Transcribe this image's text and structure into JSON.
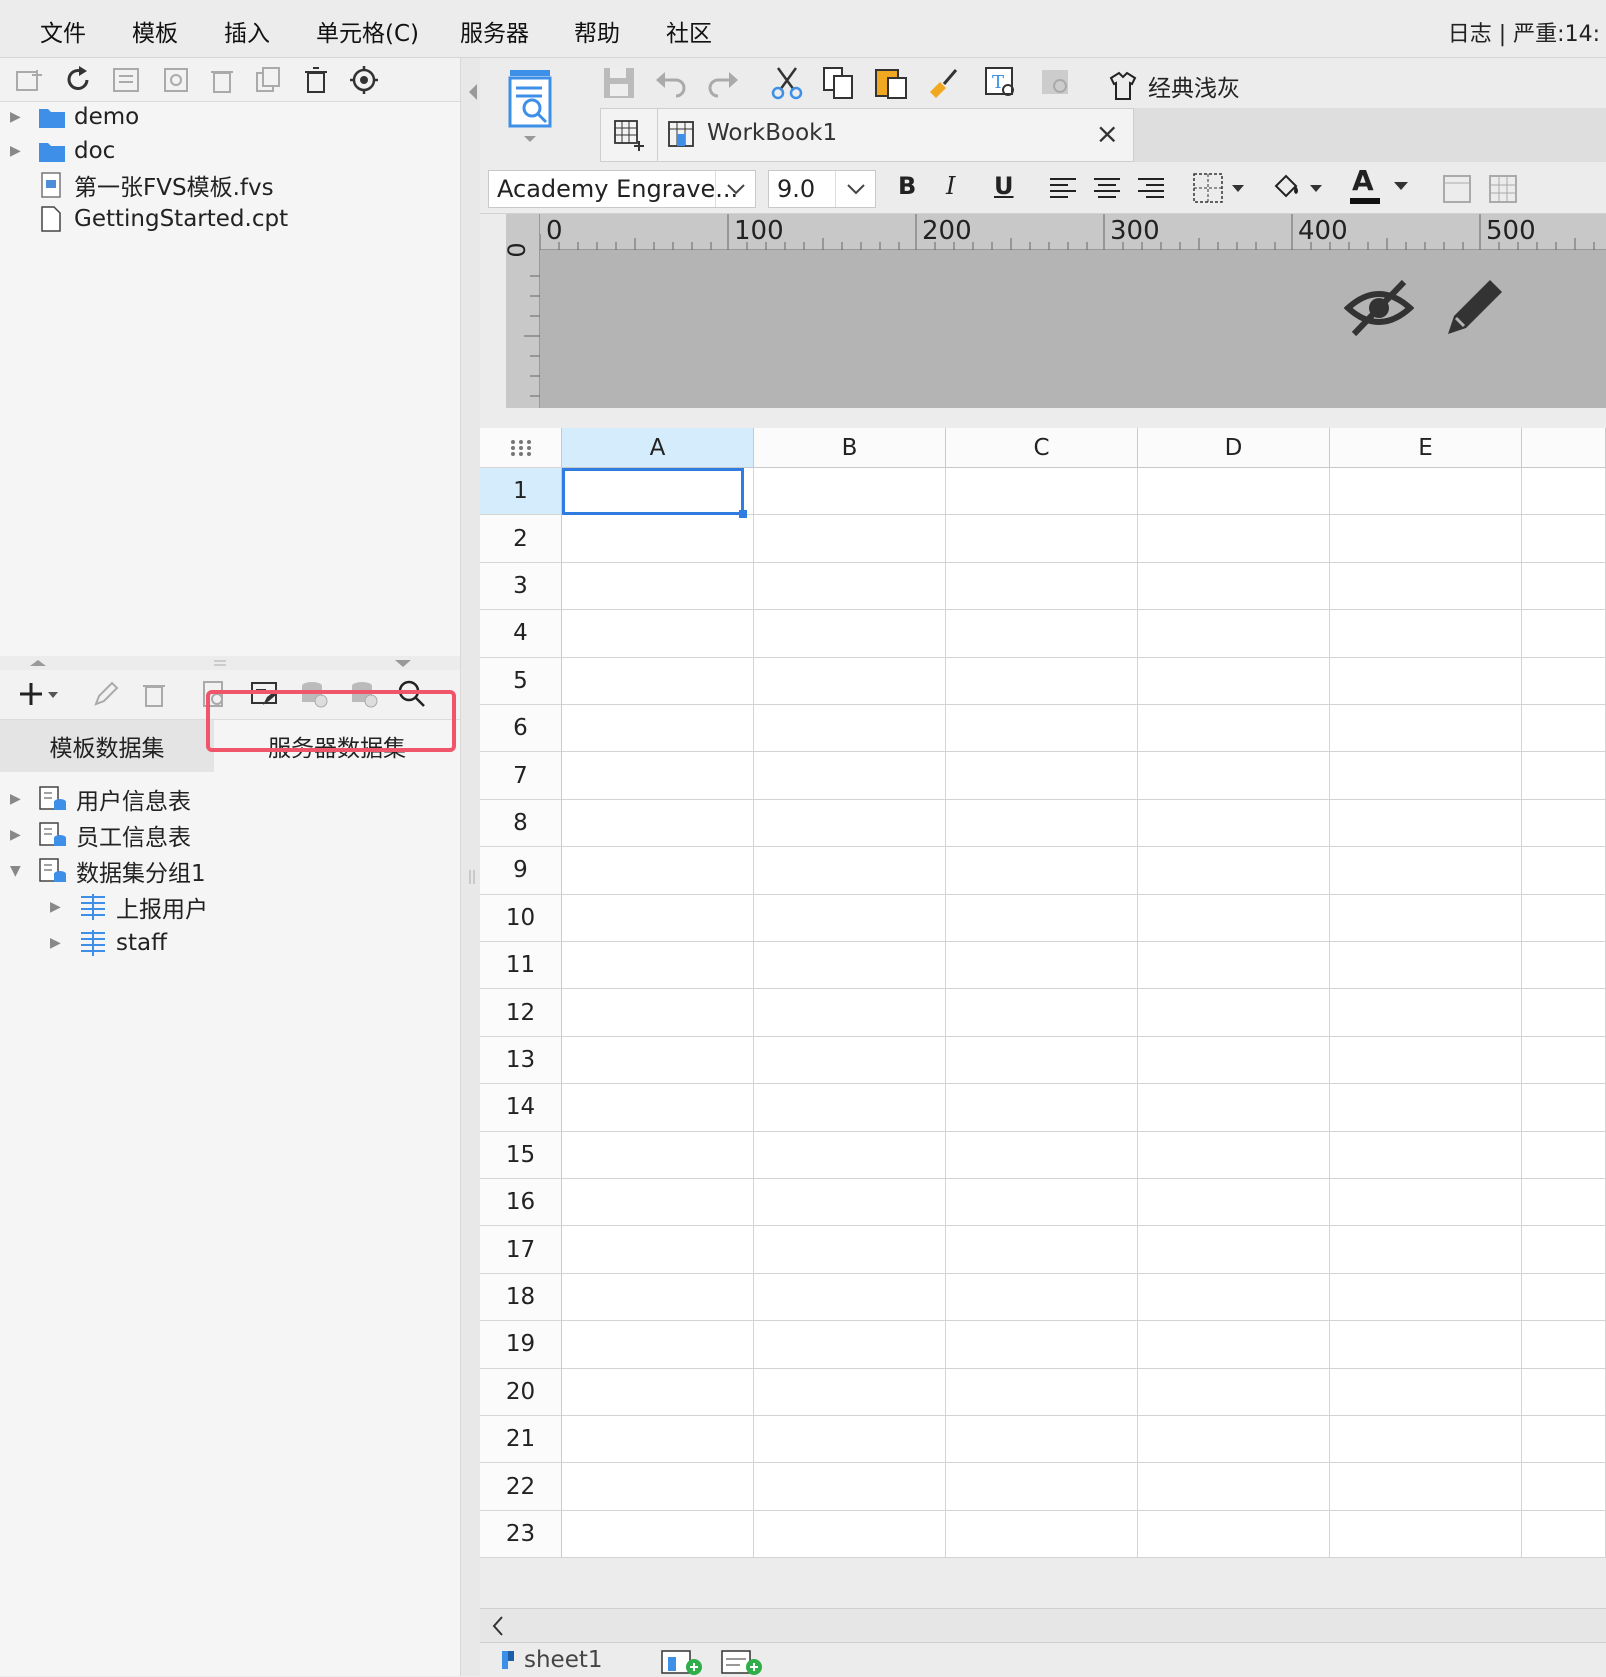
{
  "menu": [
    "文件",
    "模板",
    "插入",
    "单元格(C)",
    "服务器",
    "帮助",
    "社区"
  ],
  "log_status": "日志 | 严重:14:",
  "file_tree": [
    {
      "label": "demo",
      "type": "folder",
      "icon": "folder-icon"
    },
    {
      "label": "doc",
      "type": "folder",
      "icon": "folder-icon"
    },
    {
      "label": "第一张FVS模板.fvs",
      "type": "file",
      "icon": "fvs-file-icon"
    },
    {
      "label": "GettingStarted.cpt",
      "type": "file",
      "icon": "file-icon"
    }
  ],
  "dataset_tabs": {
    "template": "模板数据集",
    "server": "服务器数据集",
    "active": "server",
    "highlight_color": "#f0556a"
  },
  "dataset_tree": [
    {
      "label": "用户信息表",
      "level": 0,
      "expanded": false,
      "icon": "dataset-icon"
    },
    {
      "label": "员工信息表",
      "level": 0,
      "expanded": false,
      "icon": "dataset-icon"
    },
    {
      "label": "数据集分组1",
      "level": 0,
      "expanded": true,
      "icon": "dataset-icon"
    },
    {
      "label": "上报用户",
      "level": 1,
      "expanded": false,
      "icon": "table-icon"
    },
    {
      "label": "staff",
      "level": 1,
      "expanded": false,
      "icon": "table-icon"
    }
  ],
  "theme": {
    "label": "经典浅灰"
  },
  "workbook": {
    "tab_label": "WorkBook1",
    "close": "×"
  },
  "format": {
    "font": "Academy Engrave...",
    "size": "9.0",
    "bold": "B",
    "italic": "I",
    "underline": "U",
    "font_color_letter": "A"
  },
  "ruler": {
    "labels": [
      "0",
      "100",
      "200",
      "300",
      "400",
      "500"
    ],
    "vertical_zero": "0"
  },
  "grid": {
    "columns": [
      "A",
      "B",
      "C",
      "D",
      "E"
    ],
    "rows": [
      "1",
      "2",
      "3",
      "4",
      "5",
      "6",
      "7",
      "8",
      "9",
      "10",
      "11",
      "12",
      "13",
      "14",
      "15",
      "16",
      "17",
      "18",
      "19",
      "20",
      "21",
      "22",
      "23"
    ],
    "selected_cell": "A1",
    "selection_color": "#2f7de1"
  },
  "sheets": {
    "active": "sheet1"
  }
}
